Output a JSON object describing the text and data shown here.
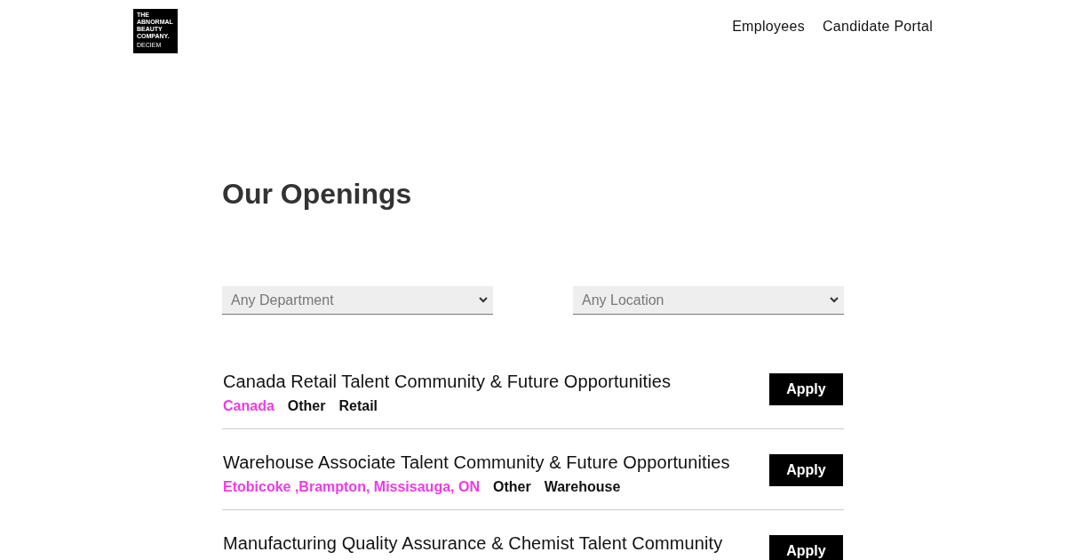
{
  "logo": {
    "lines": [
      "THE",
      "ABNORMAL",
      "BEAUTY",
      "COMPANY."
    ],
    "sub": "DECIEM"
  },
  "nav": [
    "Employees",
    "Candidate Portal"
  ],
  "heading": "Our Openings",
  "filters": [
    {
      "placeholder": "Any Department"
    },
    {
      "placeholder": "Any Location"
    }
  ],
  "jobs": [
    {
      "title": "Canada Retail Talent Community & Future Opportunities",
      "tags": [
        {
          "kind": "location",
          "text": "Canada"
        },
        {
          "kind": "plain",
          "text": "Other"
        },
        {
          "kind": "plain",
          "text": "Retail"
        }
      ],
      "button": "Apply"
    },
    {
      "title": "Warehouse Associate Talent Community & Future Opportunities",
      "tags": [
        {
          "kind": "location",
          "text": "Etobicoke ,Brampton, Missisauga, ON"
        },
        {
          "kind": "plain",
          "text": "Other"
        },
        {
          "kind": "plain",
          "text": "Warehouse"
        }
      ],
      "button": "Apply"
    },
    {
      "title": "Manufacturing Quality Assurance & Chemist Talent Community",
      "button": "Apply"
    }
  ]
}
